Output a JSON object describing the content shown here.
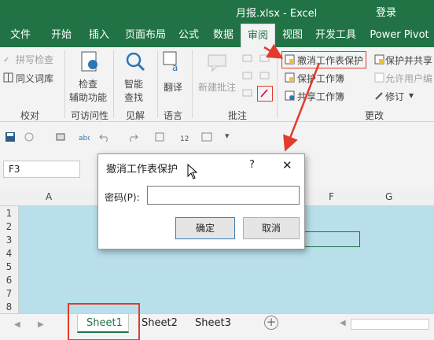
{
  "titlebar": {
    "title": "月报.xlsx  -  Excel",
    "login": "登录"
  },
  "tabs": [
    "文件",
    "开始",
    "插入",
    "页面布局",
    "公式",
    "数据",
    "审阅",
    "视图",
    "开发工具",
    "Power Pivot"
  ],
  "ribbon": {
    "proof": {
      "spell": "拼写检查",
      "thesaurus": "同义词库",
      "group": "校对"
    },
    "access": {
      "check_line1": "检查",
      "check_line2": "辅助功能",
      "group": "可访问性"
    },
    "insights": {
      "smart_line1": "智能",
      "smart_line2": "查找",
      "group": "见解"
    },
    "language": {
      "translate": "翻译",
      "group": "语言"
    },
    "comments": {
      "new_comment": "新建批注",
      "group": "批注"
    },
    "changes": {
      "unprotect_sheet": "撤消工作表保护",
      "protect_workbook": "保护工作簿",
      "share_workbook": "共享工作簿",
      "protect_share": "保护并共享",
      "allow_edit": "允许用户编",
      "track": "修订",
      "group": "更改"
    }
  },
  "namebox": "F3",
  "columns": [
    "A",
    "F",
    "G"
  ],
  "rows": [
    "1",
    "2",
    "3",
    "4",
    "5",
    "6",
    "7",
    "8"
  ],
  "dialog": {
    "title": "撤消工作表保护",
    "help": "?",
    "close": "✕",
    "password_label": "密码(P):",
    "password_value": "",
    "ok": "确定",
    "cancel": "取消"
  },
  "sheets": [
    "Sheet1",
    "Sheet2",
    "Sheet3"
  ],
  "add_sheet": "+",
  "colors": {
    "accent": "#217346",
    "cells": "#b9dfeb",
    "highlight": "#e23b2b"
  }
}
